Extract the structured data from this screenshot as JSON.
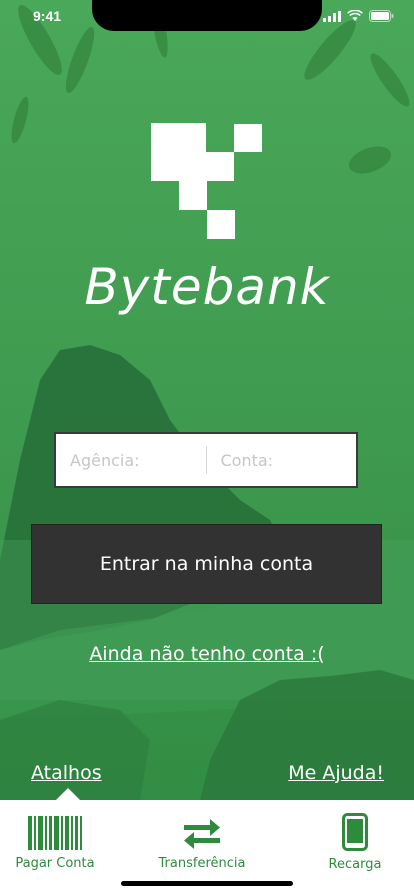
{
  "status_bar": {
    "time": "9:41"
  },
  "brand": {
    "name": "Bytebank"
  },
  "login": {
    "agencia_placeholder": "Agência:",
    "conta_placeholder": "Conta:",
    "submit_label": "Entrar na minha conta",
    "signup_link": "Ainda não tenho conta :("
  },
  "footer_links": {
    "shortcuts": "Atalhos",
    "help": "Me Ajuda!"
  },
  "shortcuts": [
    {
      "label": "Pagar Conta",
      "icon": "barcode-icon"
    },
    {
      "label": "Transferência",
      "icon": "transfer-arrows-icon"
    },
    {
      "label": "Recarga",
      "icon": "smartphone-icon"
    }
  ],
  "colors": {
    "brand_green": "#2e8b3c",
    "button_dark": "#323232"
  }
}
